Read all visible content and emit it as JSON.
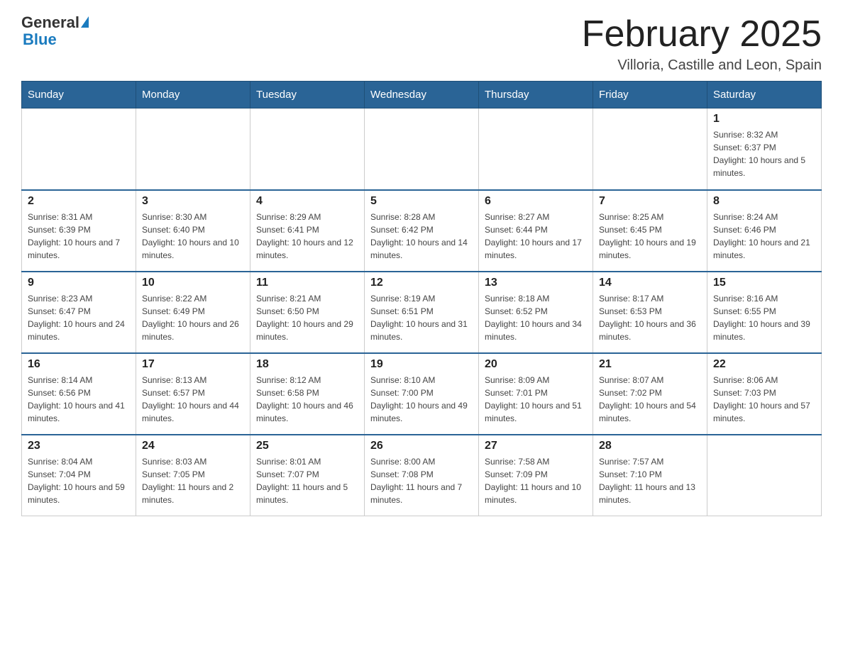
{
  "header": {
    "logo": {
      "general": "General",
      "blue": "Blue"
    },
    "title": "February 2025",
    "location": "Villoria, Castille and Leon, Spain"
  },
  "days_of_week": [
    "Sunday",
    "Monday",
    "Tuesday",
    "Wednesday",
    "Thursday",
    "Friday",
    "Saturday"
  ],
  "weeks": [
    [
      {
        "day": "",
        "info": ""
      },
      {
        "day": "",
        "info": ""
      },
      {
        "day": "",
        "info": ""
      },
      {
        "day": "",
        "info": ""
      },
      {
        "day": "",
        "info": ""
      },
      {
        "day": "",
        "info": ""
      },
      {
        "day": "1",
        "info": "Sunrise: 8:32 AM\nSunset: 6:37 PM\nDaylight: 10 hours and 5 minutes."
      }
    ],
    [
      {
        "day": "2",
        "info": "Sunrise: 8:31 AM\nSunset: 6:39 PM\nDaylight: 10 hours and 7 minutes."
      },
      {
        "day": "3",
        "info": "Sunrise: 8:30 AM\nSunset: 6:40 PM\nDaylight: 10 hours and 10 minutes."
      },
      {
        "day": "4",
        "info": "Sunrise: 8:29 AM\nSunset: 6:41 PM\nDaylight: 10 hours and 12 minutes."
      },
      {
        "day": "5",
        "info": "Sunrise: 8:28 AM\nSunset: 6:42 PM\nDaylight: 10 hours and 14 minutes."
      },
      {
        "day": "6",
        "info": "Sunrise: 8:27 AM\nSunset: 6:44 PM\nDaylight: 10 hours and 17 minutes."
      },
      {
        "day": "7",
        "info": "Sunrise: 8:25 AM\nSunset: 6:45 PM\nDaylight: 10 hours and 19 minutes."
      },
      {
        "day": "8",
        "info": "Sunrise: 8:24 AM\nSunset: 6:46 PM\nDaylight: 10 hours and 21 minutes."
      }
    ],
    [
      {
        "day": "9",
        "info": "Sunrise: 8:23 AM\nSunset: 6:47 PM\nDaylight: 10 hours and 24 minutes."
      },
      {
        "day": "10",
        "info": "Sunrise: 8:22 AM\nSunset: 6:49 PM\nDaylight: 10 hours and 26 minutes."
      },
      {
        "day": "11",
        "info": "Sunrise: 8:21 AM\nSunset: 6:50 PM\nDaylight: 10 hours and 29 minutes."
      },
      {
        "day": "12",
        "info": "Sunrise: 8:19 AM\nSunset: 6:51 PM\nDaylight: 10 hours and 31 minutes."
      },
      {
        "day": "13",
        "info": "Sunrise: 8:18 AM\nSunset: 6:52 PM\nDaylight: 10 hours and 34 minutes."
      },
      {
        "day": "14",
        "info": "Sunrise: 8:17 AM\nSunset: 6:53 PM\nDaylight: 10 hours and 36 minutes."
      },
      {
        "day": "15",
        "info": "Sunrise: 8:16 AM\nSunset: 6:55 PM\nDaylight: 10 hours and 39 minutes."
      }
    ],
    [
      {
        "day": "16",
        "info": "Sunrise: 8:14 AM\nSunset: 6:56 PM\nDaylight: 10 hours and 41 minutes."
      },
      {
        "day": "17",
        "info": "Sunrise: 8:13 AM\nSunset: 6:57 PM\nDaylight: 10 hours and 44 minutes."
      },
      {
        "day": "18",
        "info": "Sunrise: 8:12 AM\nSunset: 6:58 PM\nDaylight: 10 hours and 46 minutes."
      },
      {
        "day": "19",
        "info": "Sunrise: 8:10 AM\nSunset: 7:00 PM\nDaylight: 10 hours and 49 minutes."
      },
      {
        "day": "20",
        "info": "Sunrise: 8:09 AM\nSunset: 7:01 PM\nDaylight: 10 hours and 51 minutes."
      },
      {
        "day": "21",
        "info": "Sunrise: 8:07 AM\nSunset: 7:02 PM\nDaylight: 10 hours and 54 minutes."
      },
      {
        "day": "22",
        "info": "Sunrise: 8:06 AM\nSunset: 7:03 PM\nDaylight: 10 hours and 57 minutes."
      }
    ],
    [
      {
        "day": "23",
        "info": "Sunrise: 8:04 AM\nSunset: 7:04 PM\nDaylight: 10 hours and 59 minutes."
      },
      {
        "day": "24",
        "info": "Sunrise: 8:03 AM\nSunset: 7:05 PM\nDaylight: 11 hours and 2 minutes."
      },
      {
        "day": "25",
        "info": "Sunrise: 8:01 AM\nSunset: 7:07 PM\nDaylight: 11 hours and 5 minutes."
      },
      {
        "day": "26",
        "info": "Sunrise: 8:00 AM\nSunset: 7:08 PM\nDaylight: 11 hours and 7 minutes."
      },
      {
        "day": "27",
        "info": "Sunrise: 7:58 AM\nSunset: 7:09 PM\nDaylight: 11 hours and 10 minutes."
      },
      {
        "day": "28",
        "info": "Sunrise: 7:57 AM\nSunset: 7:10 PM\nDaylight: 11 hours and 13 minutes."
      },
      {
        "day": "",
        "info": ""
      }
    ]
  ]
}
